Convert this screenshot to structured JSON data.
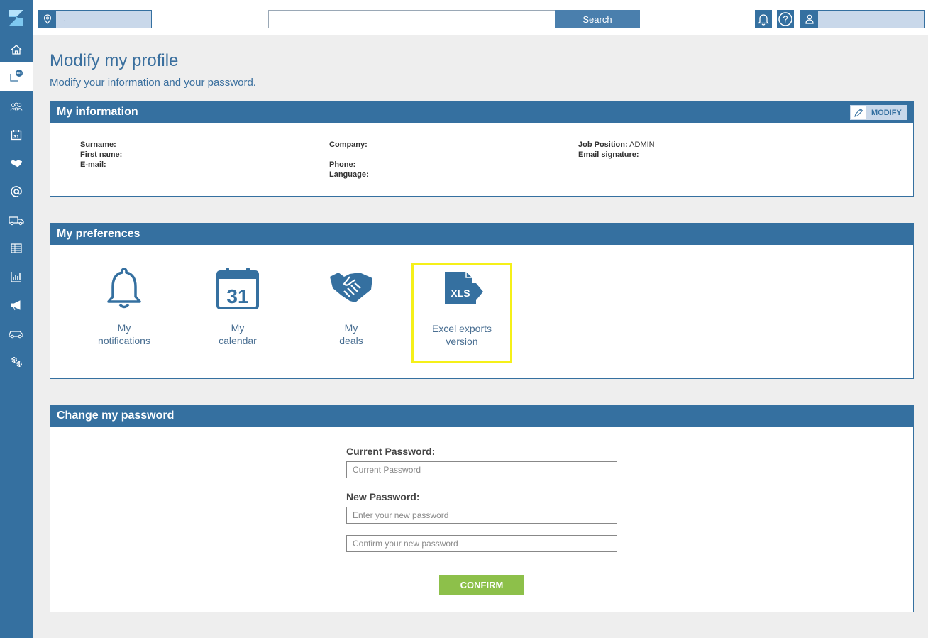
{
  "app": {
    "logo_letter": "Z",
    "accent": "#3570a0",
    "sidebar_icons": [
      "home-icon",
      "activity-chat-icon",
      "contacts-icon",
      "calendar-icon",
      "deals-handshake-icon",
      "email-at-icon",
      "delivery-truck-icon",
      "table-icon",
      "bar-chart-icon",
      "megaphone-icon",
      "car-icon",
      "settings-gears-icon"
    ]
  },
  "topbar": {
    "location_value": ".",
    "search_placeholder": "",
    "search_button": "Search",
    "user_name": ""
  },
  "page": {
    "title": "Modify my profile",
    "subtitle": "Modify your information and your password."
  },
  "info": {
    "header": "My information",
    "modify_label": "MODIFY",
    "surname_label": "Surname:",
    "firstname_label": "First name:",
    "email_label": "E-mail:",
    "company_label": "Company:",
    "phone_label": "Phone:",
    "language_label": "Language:",
    "jobposition_label": "Job Position:",
    "jobposition_value": "ADMIN",
    "signature_label": "Email signature:"
  },
  "preferences": {
    "header": "My preferences",
    "items": [
      {
        "line1": "My",
        "line2": "notifications"
      },
      {
        "line1": "My",
        "line2": "calendar",
        "icon_number": "31"
      },
      {
        "line1": "My",
        "line2": "deals"
      },
      {
        "line1": "Excel exports",
        "line2": "version",
        "icon_text": "XLS"
      }
    ],
    "highlight_color": "#f5f019"
  },
  "password": {
    "header": "Change my password",
    "current_label": "Current Password:",
    "current_placeholder": "Current Password",
    "new_label": "New Password:",
    "new_placeholder": "Enter your new password",
    "confirm_placeholder": "Confirm your new password",
    "confirm_button": "CONFIRM",
    "confirm_color": "#8dc04a"
  }
}
